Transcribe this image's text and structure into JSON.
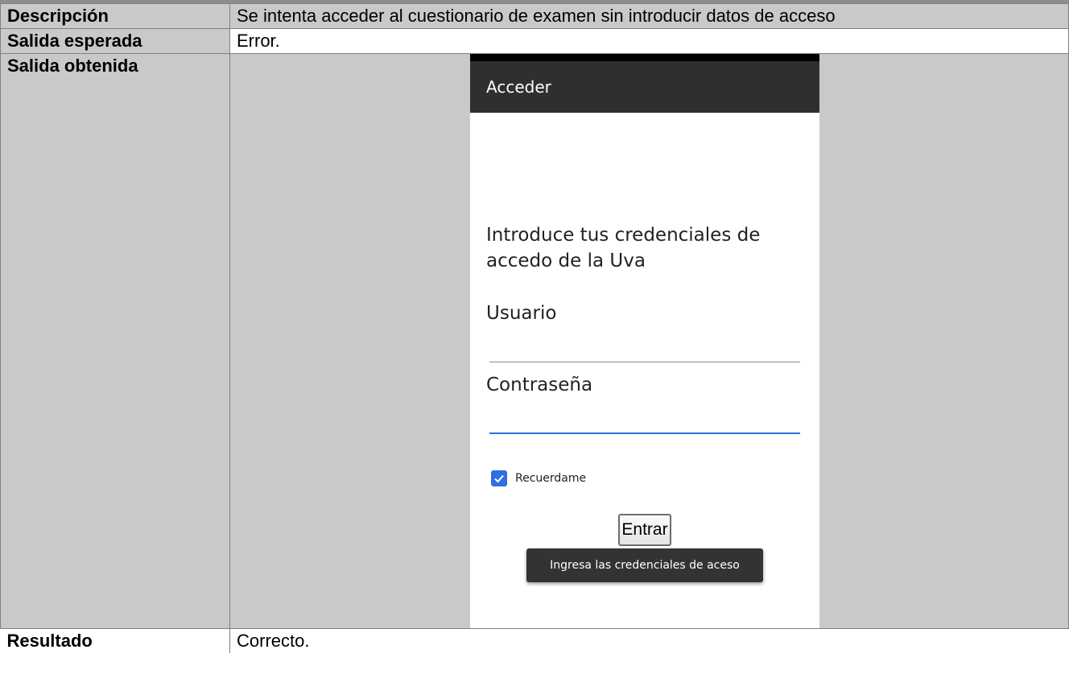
{
  "table": {
    "rows": [
      {
        "label": "Descripción",
        "value": "Se intenta acceder al cuestionario de examen sin introducir datos de acceso"
      },
      {
        "label": "Salida esperada",
        "value": "Error."
      },
      {
        "label": "Salida obtenida"
      },
      {
        "label": "Resultado",
        "value": "Correcto."
      }
    ]
  },
  "phone": {
    "app_bar_title": "Acceder",
    "intro_text": "Introduce tus credenciales de accedo de la Uva",
    "user_label": "Usuario",
    "password_label": "Contraseña",
    "remember_label": "Recuerdame",
    "remember_checked": true,
    "enter_button": "Entrar",
    "toast_message": "Ingresa las credenciales de aceso"
  },
  "colors": {
    "label_cell_bg": "#c9c9c9",
    "app_bar_bg": "#2f2f2f",
    "accent_blue": "#2f6fe0",
    "toast_bg": "#333333"
  }
}
